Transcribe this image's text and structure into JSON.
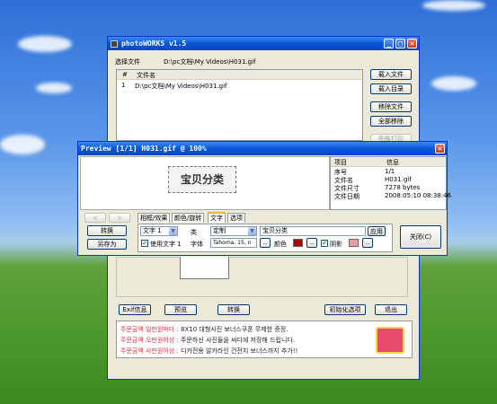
{
  "colors": {
    "title_bar": "#0a56d6",
    "banner_bg": "#ffffff",
    "banner_text": "#e8293c",
    "swatch_color": "#b50000",
    "swatch_shadow": "#f39aa0"
  },
  "main": {
    "title": "photoWORKS v1.5",
    "file_label": "选择文件",
    "file_path": "D:\\pc文档\\My Videos\\H031.gif",
    "table_headers": [
      "#",
      "文件名"
    ],
    "rows": [
      {
        "num": "1",
        "name": "D:\\pc文档\\My Videos\\H031.gif"
      }
    ],
    "side_buttons": [
      "载入文件",
      "载入目录",
      "移除文件",
      "全部移除",
      "图像打印"
    ],
    "bottom_buttons": [
      "Exif信息",
      "预览",
      "转换",
      "初始化选项",
      "退出"
    ],
    "banner_lines": [
      {
        "left": "주문금액 일만원마다 :",
        "right": "8X10 대형사진 보너스쿠폰 무제한 증정."
      },
      {
        "left": "주문금액 오만원이상 :",
        "right": "주문하신 사진들을 씨디에 저장해 드립니다."
      },
      {
        "left": "주문금액 사만원이상 :",
        "right": "디카전용 알카라인 건전지 보너스까지 추가!!"
      }
    ]
  },
  "preview": {
    "title": "Preview [1/1] H031.gif @ 100%",
    "image_text": "宝贝分类",
    "info_headers": [
      "项目",
      "信息"
    ],
    "info_rows": [
      {
        "key": "序号",
        "val": "1/1"
      },
      {
        "key": "文件名",
        "val": "H031.gif"
      },
      {
        "key": "文件尺寸",
        "val": "7278 bytes"
      },
      {
        "key": "文件日期",
        "val": "2008:05:10 08:38:46"
      }
    ],
    "nav_prev": "<",
    "nav_next": ">",
    "convert": "转换",
    "save_as": "另存为",
    "tabs": [
      "相框/效果",
      "颜色/旋转",
      "文字",
      "选项"
    ],
    "active_tab": "文字",
    "text_select": "文字 1",
    "type_label": "类",
    "type_value": "定制",
    "text_value": "宝贝分类",
    "apply": "应用",
    "use_text_label": "使用文字 1",
    "font_label": "字体",
    "font_value": "Tahoma, 15, n",
    "ellipsis": "..",
    "color_label": "颜色",
    "shadow_label": "阴影",
    "close": "关闭(C)"
  }
}
